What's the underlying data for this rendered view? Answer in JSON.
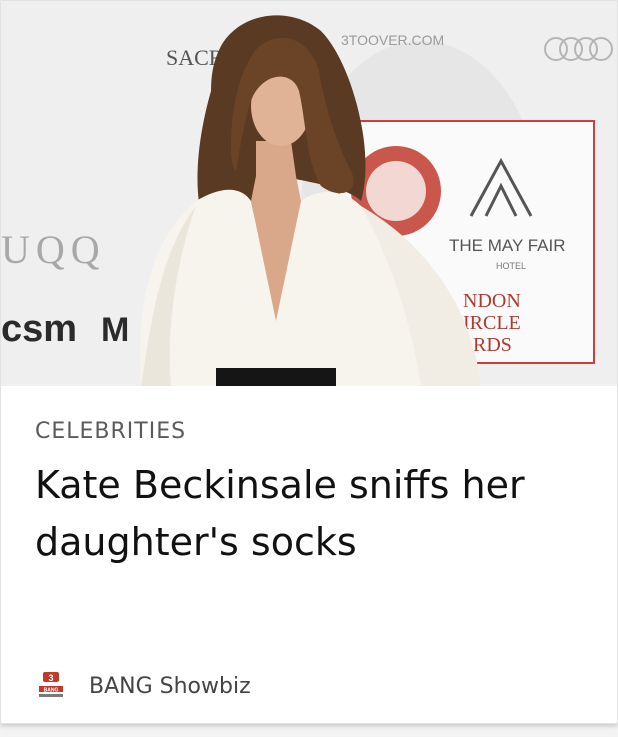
{
  "card": {
    "category": "CELEBRITIES",
    "headline": "Kate Beckinsale sniffs her daughter's socks",
    "source": {
      "name": "BANG Showbiz",
      "logo_icon": "bang-showbiz-logo"
    },
    "image": {
      "backdrop_texts": [
        "SACRE",
        "3TOOVER.COM",
        "UQQ",
        "csm",
        "M",
        "THE MAY FAIR",
        "HOTEL",
        "NDON",
        "IRCLE",
        "RDS"
      ]
    }
  },
  "colors": {
    "accent_red": "#c0392b",
    "category_text": "#5a5a5a",
    "headline_text": "#111111"
  }
}
